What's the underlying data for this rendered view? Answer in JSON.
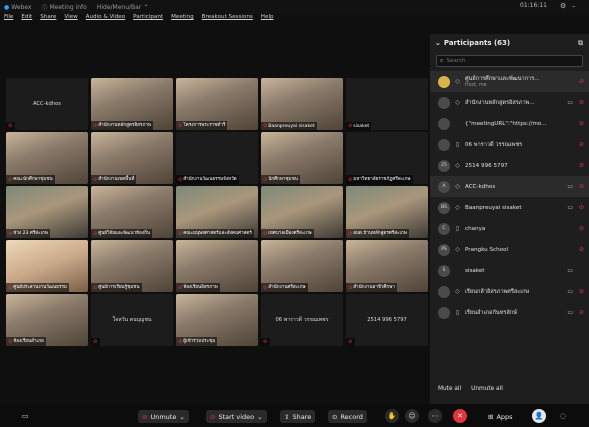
{
  "topbar": {
    "items": [
      "Webex",
      "Meeting info",
      "Hide/Menu/Bar"
    ],
    "timer": "01:16:11"
  },
  "menu": [
    "File",
    "Edit",
    "Share",
    "View",
    "Audio & Video",
    "Participant",
    "Meeting",
    "Breakout Sessions",
    "Help"
  ],
  "grid": {
    "tiles": [
      {
        "label": "ACC-kdhos",
        "style": "dark",
        "centered": true
      },
      {
        "label": "สำนักงานหลักสูตรอิสรภาพ",
        "style": "room"
      },
      {
        "label": "โครงการพระราชดำริ",
        "style": "room"
      },
      {
        "label": "Baanpreuyai sisaket",
        "style": "room"
      },
      {
        "label": "sisaket",
        "style": "dark",
        "centered": false
      },
      {
        "label": "คณะนักศึกษาชุมชน",
        "style": "room"
      },
      {
        "label": "สำนักงานเขตพื้นที่",
        "style": "room"
      },
      {
        "label": "สำนักงานวัฒนธรรมจังหวัด",
        "style": "dark"
      },
      {
        "label": "นักศึกษาชุมชน",
        "style": "room"
      },
      {
        "label": "มหาวิทยาลัยราชภัฏศรีสะเกษ",
        "style": "dark"
      },
      {
        "label": "ช่วง 23 ศรีสะเกษ",
        "style": "person"
      },
      {
        "label": "ศูนย์วิจัยและพัฒนาท้องถิ่น",
        "style": "room"
      },
      {
        "label": "คณะมนุษยศาสตร์และสังคมศาสตร์",
        "style": "person"
      },
      {
        "label": "เทศบาลเมืองศรีสะเกษ",
        "style": "person"
      },
      {
        "label": "อบต.บ้านหลักสูตรศรีสะเกษ",
        "style": "person"
      },
      {
        "label": "ศูนย์ประสานงานวัฒนธรรม",
        "style": "screen"
      },
      {
        "label": "ศูนย์การเรียนรู้ชุมชน",
        "style": "room"
      },
      {
        "label": "ห้องเรียนอิสรภาพ",
        "style": "room"
      },
      {
        "label": "สำนักงานศรีสะเกษ",
        "style": "room"
      },
      {
        "label": "สำนักงานอาชีวศึกษา",
        "style": "room"
      },
      {
        "label": "ห้องเรียนอำเภอ",
        "style": "room"
      },
      {
        "label": "ใจหวัน ตนบุญชน",
        "style": "dark",
        "centered": true
      },
      {
        "label": "ผู้เข้าร่วมประชุม",
        "style": "room"
      },
      {
        "label": "06 พาราวดี วรรณเพชร",
        "style": "dark",
        "centered": true
      },
      {
        "label": "2514 996 5797",
        "style": "dark",
        "centered": true
      }
    ]
  },
  "panel": {
    "title": "Participants (63)",
    "search_placeholder": "Search",
    "participants": [
      {
        "initials": "",
        "name": "ศูนย์การศึกษาและพัฒนาการ...",
        "sub": "Host, me",
        "device": "◇",
        "video": "",
        "muted": true,
        "selected": true
      },
      {
        "initials": "",
        "name": "สำนักงานหลักสูตรอิสรภาพ...",
        "sub": "",
        "device": "◇",
        "video": "▭",
        "muted": true
      },
      {
        "initials": "",
        "name": "{\"meetingURL\":\"https://mo...",
        "sub": "",
        "device": "",
        "video": "",
        "muted": true
      },
      {
        "initials": "",
        "name": "06 พาราวดี วรรณเพชร",
        "sub": "",
        "device": "▯",
        "video": "",
        "muted": true
      },
      {
        "initials": "25",
        "name": "2514 996 5797",
        "sub": "",
        "device": "◇",
        "video": "",
        "muted": true
      },
      {
        "initials": "A",
        "name": "ACC-kdhos",
        "sub": "",
        "device": "◇",
        "video": "▭",
        "muted": true,
        "selected": true
      },
      {
        "initials": "BS",
        "name": "Baanpreuyai sisaket",
        "sub": "",
        "device": "◇",
        "video": "▭",
        "muted": true
      },
      {
        "initials": "C",
        "name": "chanya",
        "sub": "",
        "device": "▯",
        "video": "",
        "muted": true
      },
      {
        "initials": "PS",
        "name": "Prangku School",
        "sub": "",
        "device": "◇",
        "video": "",
        "muted": true
      },
      {
        "initials": "S",
        "name": "sisaket",
        "sub": "",
        "device": "",
        "video": "▭",
        "muted": false
      },
      {
        "initials": "",
        "name": "เรียนกล้าอิสรภาพศรีสะเกษ",
        "sub": "",
        "device": "◇",
        "video": "▭",
        "muted": true
      },
      {
        "initials": "",
        "name": "เรียนอำเภอกันทรลักษ์",
        "sub": "",
        "device": "▯",
        "video": "▭",
        "muted": true
      }
    ],
    "mute_all": "Mute all",
    "unmute_all": "Unmute all"
  },
  "toolbar": {
    "unmute": "Unmute",
    "start_video": "Start video",
    "share": "Share",
    "record": "Record",
    "apps": "Apps"
  },
  "colors": {
    "mute_red": "#e0353b",
    "panel_bg": "#1e1e1e",
    "app_bg": "#0f0f0f"
  }
}
